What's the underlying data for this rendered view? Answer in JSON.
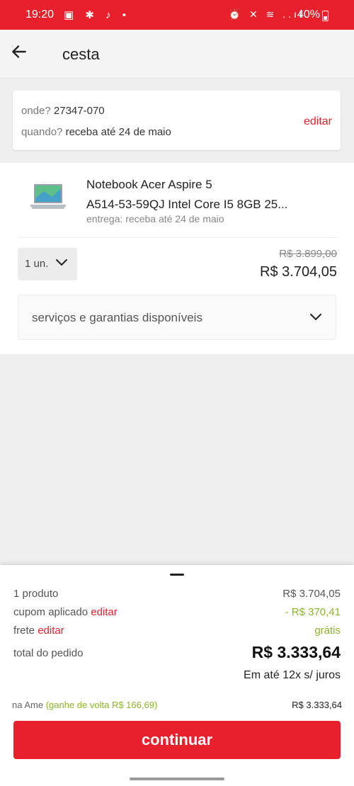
{
  "status_bar": {
    "time": "19:20",
    "battery": "40%",
    "left_icons": "▣ ✱ ♪ •",
    "right_icons": "⏰ ✕ ≋ ..ıl",
    "color": "#e8202c"
  },
  "header": {
    "title": "cesta",
    "back_icon": "arrow-left-icon"
  },
  "delivery": {
    "where_label": "onde?",
    "cep": "27347-070",
    "when_label": "quando?",
    "when_value": "receba até 24 de maio",
    "edit_label": "editar"
  },
  "product": {
    "name_line1": "Notebook Acer Aspire 5",
    "name_line2": "A514-53-59QJ Intel Core I5 8GB 25...",
    "delivery": "entrega: receba até 24 de maio",
    "quantity": "1 un.",
    "old_price": "R$ 3.899,00",
    "price": "R$ 3.704,05",
    "image_icon": "laptop-icon"
  },
  "services": {
    "label": "serviços e garantias disponíveis"
  },
  "summary": {
    "products_label": "1 produto",
    "products_value": "R$ 3.704,05",
    "coupon_label": "cupom aplicado",
    "coupon_edit": "editar",
    "coupon_value": "- R$ 370,41",
    "shipping_label": "frete",
    "shipping_edit": "editar",
    "shipping_value": "grátis",
    "total_label": "total do pedido",
    "total_value": "R$ 3.333,64",
    "installments": "Em até 12x s/ juros",
    "ame_label": "na Ame",
    "ame_cashback": "(ganhe de volta R$ 166,69)",
    "ame_value": "R$ 3.333,64"
  },
  "continue_label": "continuar",
  "colors": {
    "accent": "#e8202c",
    "green": "#8bb52c"
  }
}
